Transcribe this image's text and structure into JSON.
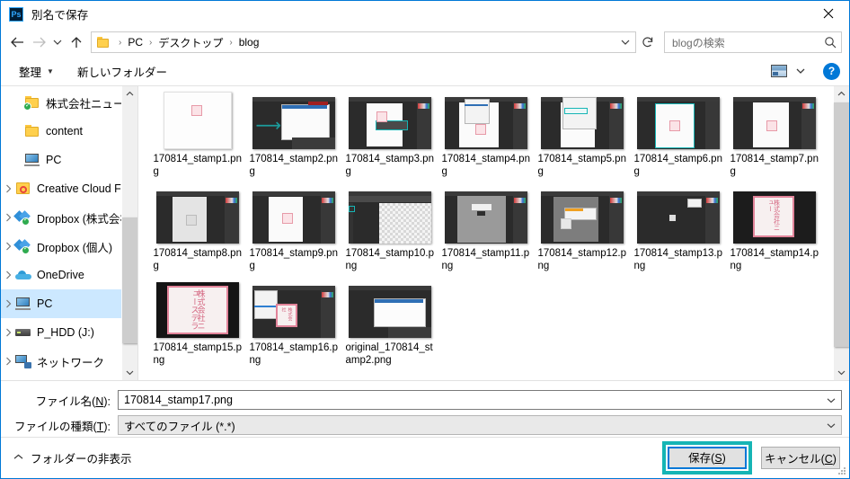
{
  "window": {
    "title": "別名で保存",
    "app_icon": "photoshop-icon",
    "app_icon_text": "Ps",
    "close_label": "×"
  },
  "navbar": {
    "back_icon": "back-arrow-icon",
    "forward_icon": "forward-arrow-icon",
    "recent_icon": "chevron-down-icon",
    "up_icon": "up-arrow-icon",
    "breadcrumb": [
      "PC",
      "デスクトップ",
      "blog"
    ],
    "separator": "›",
    "dropdown_icon": "chevron-down-icon",
    "refresh_icon": "refresh-icon",
    "search": {
      "placeholder": "blogの検索",
      "icon": "search-icon"
    }
  },
  "toolbar": {
    "organize_label": "整理",
    "organize_caret": "▼",
    "new_folder_label": "新しいフォルダー",
    "view_icon": "view-mode-icon",
    "view_caret": "▼",
    "help_label": "?"
  },
  "sidebar": {
    "items": [
      {
        "label": "株式会社ニュー",
        "icon": "folder-sync-icon",
        "indent": "child",
        "pinned": true,
        "expandable": false,
        "selected": false
      },
      {
        "label": "content",
        "icon": "folder-icon",
        "indent": "child",
        "pinned": true,
        "expandable": false,
        "selected": false
      },
      {
        "label": "PC",
        "icon": "computer-icon",
        "indent": "child",
        "pinned": true,
        "expandable": false,
        "selected": false
      },
      {
        "label": "Creative Cloud File",
        "icon": "creative-cloud-icon",
        "indent": "root",
        "pinned": false,
        "expandable": true,
        "selected": false
      },
      {
        "label": "Dropbox (株式会社",
        "icon": "dropbox-icon",
        "indent": "root",
        "pinned": false,
        "expandable": true,
        "selected": false
      },
      {
        "label": "Dropbox (個人)",
        "icon": "dropbox-icon",
        "indent": "root",
        "pinned": false,
        "expandable": true,
        "selected": false
      },
      {
        "label": "OneDrive",
        "icon": "onedrive-icon",
        "indent": "root",
        "pinned": false,
        "expandable": true,
        "selected": false
      },
      {
        "label": "PC",
        "icon": "computer-icon",
        "indent": "root",
        "pinned": false,
        "expandable": true,
        "selected": true
      },
      {
        "label": "P_HDD (J:)",
        "icon": "harddisk-icon",
        "indent": "root",
        "pinned": false,
        "expandable": true,
        "selected": false
      },
      {
        "label": "ネットワーク",
        "icon": "network-icon",
        "indent": "root",
        "pinned": false,
        "expandable": true,
        "selected": false
      }
    ],
    "scroll_up_icon": "chevron-up-icon",
    "scroll_down_icon": "chevron-down-icon"
  },
  "files": [
    {
      "name": "170814_stamp1.png",
      "thumb": "white-doc-small-stamp"
    },
    {
      "name": "170814_stamp2.png",
      "thumb": "ps-dialog-arrow"
    },
    {
      "name": "170814_stamp3.png",
      "thumb": "ps-canvas-toolbar"
    },
    {
      "name": "170814_stamp4.png",
      "thumb": "ps-canvas-panel"
    },
    {
      "name": "170814_stamp5.png",
      "thumb": "ps-menu-open"
    },
    {
      "name": "170814_stamp6.png",
      "thumb": "ps-canvas-teal-top"
    },
    {
      "name": "170814_stamp7.png",
      "thumb": "ps-canvas-stamp"
    },
    {
      "name": "170814_stamp8.png",
      "thumb": "ps-canvas-gray"
    },
    {
      "name": "170814_stamp9.png",
      "thumb": "ps-canvas-pink"
    },
    {
      "name": "170814_stamp10.png",
      "thumb": "ps-checker"
    },
    {
      "name": "170814_stamp11.png",
      "thumb": "ps-gray-canvas"
    },
    {
      "name": "170814_stamp12.png",
      "thumb": "ps-dialog-small"
    },
    {
      "name": "170814_stamp13.png",
      "thumb": "ps-dark-dot"
    },
    {
      "name": "170814_stamp14.png",
      "thumb": "stamp-red-seal"
    },
    {
      "name": "170814_stamp15.png",
      "thumb": "stamp-red-seal-big"
    },
    {
      "name": "170814_stamp16.png",
      "thumb": "ps-stamp-overlay"
    },
    {
      "name": "original_170814_stamp2.png",
      "thumb": "ps-dialog-doc"
    }
  ],
  "filelist": {
    "scroll_up_icon": "chevron-up-icon",
    "scroll_down_icon": "chevron-down-icon"
  },
  "form": {
    "filename_label_pre": "ファイル名(",
    "filename_label_key": "N",
    "filename_label_post": "):",
    "filename_value": "170814_stamp17.png",
    "filetype_label_pre": "ファイルの種類(",
    "filetype_label_key": "T",
    "filetype_label_post": "):",
    "filetype_value": "すべてのファイル (*.*)",
    "chevron_icon": "chevron-down-icon"
  },
  "footer": {
    "hide_folders_label": "フォルダーの非表示",
    "hide_folders_icon": "chevron-up-icon",
    "save_label_pre": "保存(",
    "save_label_key": "S",
    "save_label_post": ")",
    "cancel_label_pre": "キャンセル(",
    "cancel_label_key": "C",
    "cancel_label_post": ")",
    "highlight_color": "#16b5b5",
    "focus_color": "#0078d7"
  }
}
